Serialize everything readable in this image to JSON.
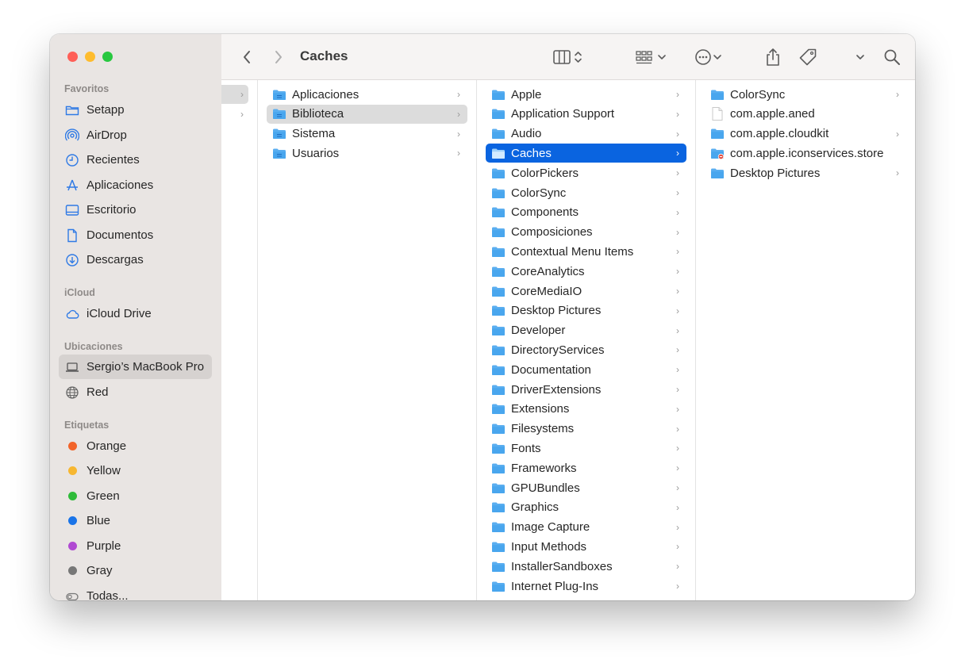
{
  "window": {
    "title": "Caches"
  },
  "sidebar": {
    "sections": [
      {
        "label": "Favoritos",
        "items": [
          {
            "label": "Setapp",
            "icon": "folder-outline-icon"
          },
          {
            "label": "AirDrop",
            "icon": "airdrop-icon"
          },
          {
            "label": "Recientes",
            "icon": "clock-icon"
          },
          {
            "label": "Aplicaciones",
            "icon": "apps-icon"
          },
          {
            "label": "Escritorio",
            "icon": "desktop-icon"
          },
          {
            "label": "Documentos",
            "icon": "document-icon"
          },
          {
            "label": "Descargas",
            "icon": "download-icon"
          }
        ]
      },
      {
        "label": "iCloud",
        "items": [
          {
            "label": "iCloud Drive",
            "icon": "cloud-icon"
          }
        ]
      },
      {
        "label": "Ubicaciones",
        "items": [
          {
            "label": "Sergio’s MacBook Pro",
            "icon": "laptop-icon",
            "selected": true
          },
          {
            "label": "Red",
            "icon": "globe-icon"
          }
        ]
      },
      {
        "label": "Etiquetas",
        "items": [
          {
            "label": "Orange",
            "color": "#f2642a"
          },
          {
            "label": "Yellow",
            "color": "#f7b731"
          },
          {
            "label": "Green",
            "color": "#2fbb3a"
          },
          {
            "label": "Blue",
            "color": "#1a74e8"
          },
          {
            "label": "Purple",
            "color": "#b04ad2"
          },
          {
            "label": "Gray",
            "color": "#777777"
          },
          {
            "label": "Todas...",
            "icon": "all-tags-icon"
          }
        ]
      }
    ]
  },
  "toolbar": {
    "back_icon": "chevron-left-icon",
    "forward_icon": "chevron-right-icon",
    "view_icon": "column-view-icon",
    "group_icon": "grid-group-icon",
    "action_icon": "more-actions-icon",
    "share_icon": "share-icon",
    "tag_icon": "tag-icon",
    "overflow_icon": "chevron-down-icon",
    "search_icon": "search-icon"
  },
  "columns": {
    "col1": [
      {
        "label": "Aplicaciones",
        "icon": "apps-folder-icon",
        "chevron": true
      },
      {
        "label": "Biblioteca",
        "icon": "library-folder-icon",
        "chevron": true,
        "selected": "gray"
      },
      {
        "label": "Sistema",
        "icon": "system-folder-icon",
        "chevron": true
      },
      {
        "label": "Usuarios",
        "icon": "users-folder-icon",
        "chevron": true
      }
    ],
    "col2": [
      {
        "label": "Apple"
      },
      {
        "label": "Application Support"
      },
      {
        "label": "Audio"
      },
      {
        "label": "Caches",
        "selected": "blue"
      },
      {
        "label": "ColorPickers"
      },
      {
        "label": "ColorSync"
      },
      {
        "label": "Components"
      },
      {
        "label": "Composiciones"
      },
      {
        "label": "Contextual Menu Items"
      },
      {
        "label": "CoreAnalytics"
      },
      {
        "label": "CoreMediaIO"
      },
      {
        "label": "Desktop Pictures"
      },
      {
        "label": "Developer"
      },
      {
        "label": "DirectoryServices"
      },
      {
        "label": "Documentation"
      },
      {
        "label": "DriverExtensions"
      },
      {
        "label": "Extensions"
      },
      {
        "label": "Filesystems"
      },
      {
        "label": "Fonts"
      },
      {
        "label": "Frameworks"
      },
      {
        "label": "GPUBundles"
      },
      {
        "label": "Graphics"
      },
      {
        "label": "Image Capture"
      },
      {
        "label": "Input Methods"
      },
      {
        "label": "InstallerSandboxes"
      },
      {
        "label": "Internet Plug-Ins"
      }
    ],
    "col3": [
      {
        "label": "ColorSync",
        "type": "folder",
        "chevron": true
      },
      {
        "label": "com.apple.aned",
        "type": "file",
        "chevron": false
      },
      {
        "label": "com.apple.cloudkit",
        "type": "folder",
        "chevron": true
      },
      {
        "label": "com.apple.iconservices.store",
        "type": "locked-folder",
        "chevron": false
      },
      {
        "label": "Desktop Pictures",
        "type": "folder",
        "chevron": true
      }
    ]
  },
  "colors": {
    "accent": "#0a64e0",
    "folder": "#4aa8ee"
  }
}
